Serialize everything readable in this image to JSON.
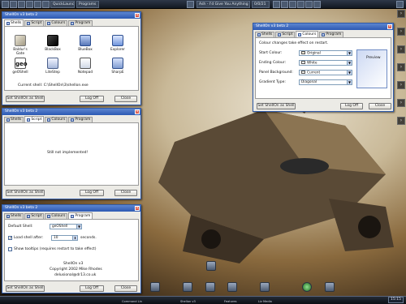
{
  "topbar": {
    "items": [
      "QuickLaunch",
      "Programs"
    ],
    "now_playing": "Ash - I'd Give You Anything",
    "counter": "0/0/21"
  },
  "taskbar": {
    "clock": "15:15",
    "labels": [
      "Command Lin",
      "Shellon v3",
      "Features",
      "Liz Media"
    ]
  },
  "win1": {
    "title": "ShellOn v3 beta 2",
    "tabs": [
      "Shells",
      "Script",
      "Colours",
      "Program"
    ],
    "shells": [
      "Baldur's Gate",
      "BlackBox",
      "BlueBox",
      "Explorer",
      "geOShell",
      "LiteStep",
      "Notepad",
      "SharpE"
    ],
    "current_shell": "Current shell: C:\\ShellOn\\3\\shellon.exe",
    "btn_set": "Set ShellOn as Shell",
    "btn_logoff": "Log Off",
    "btn_close": "Close"
  },
  "win2": {
    "title": "ShellOn v3 beta 2",
    "tabs": [
      "Shells",
      "Script",
      "Colours",
      "Program"
    ],
    "message": "Still not implemented!",
    "btn_set": "Set ShellOn as Shell",
    "btn_logoff": "Log Off",
    "btn_close": "Close"
  },
  "win3": {
    "title": "ShellOn v3 beta 2",
    "tabs": [
      "Shells",
      "Script",
      "Colours",
      "Program"
    ],
    "default_shell_label": "Default Shell:",
    "default_shell_value": "geOShell",
    "load_after_label": "Load shell after:",
    "load_after_value": "10",
    "load_after_unit": "seconds.",
    "tooltips_label": "Show tooltips (requires restart to take effect)",
    "about_name": "ShellOn v3",
    "about_copy": "Copyright 2002 Mike Rhodes",
    "about_email": "delusional@dr13.co.uk",
    "btn_set": "Set ShellOn as Shell",
    "btn_logoff": "Log Off",
    "btn_close": "Close"
  },
  "win4": {
    "title": "ShellOn v3 beta 2",
    "tabs": [
      "Shells",
      "Script",
      "Colours",
      "Program"
    ],
    "note": "Colour changes take effect on restart.",
    "start_label": "Start Colour:",
    "start_value": "Original",
    "end_label": "Ending Colour:",
    "end_value": "White",
    "bg_label": "Panel Background:",
    "bg_value": "Current",
    "grad_label": "Gradient Type:",
    "grad_value": "Diagonal",
    "preview": "Preview",
    "btn_set": "Set ShellOn as Shell",
    "btn_logoff": "Log Off",
    "btn_close": "Close"
  },
  "colors": {
    "title_blue": "#2c59b3",
    "window_bg": "#ecebe6"
  }
}
